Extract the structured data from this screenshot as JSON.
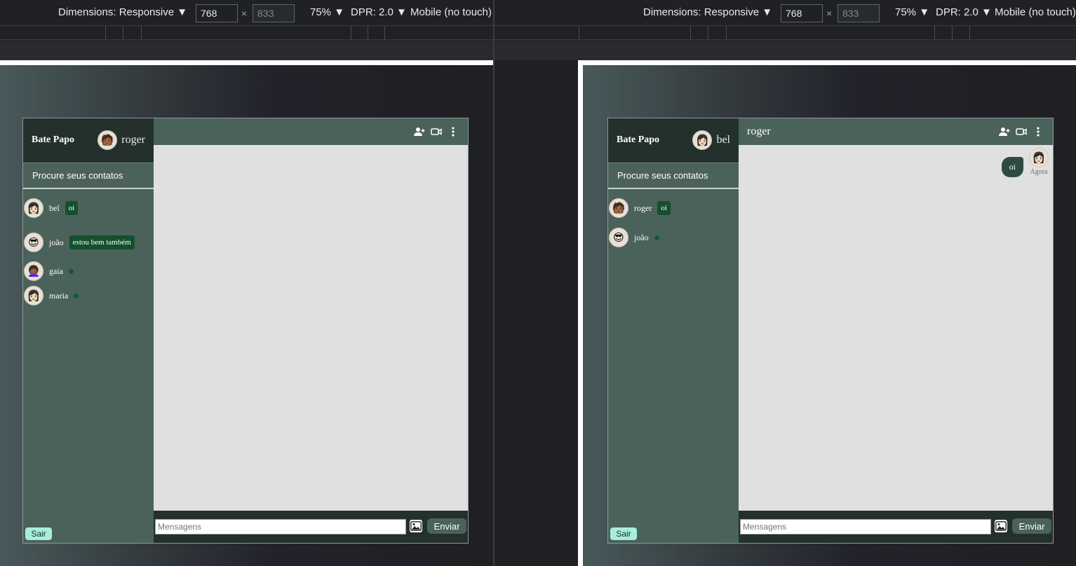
{
  "devtools": {
    "dimensions_label": "Dimensions: Responsive ▼",
    "width_value": "768",
    "times": "×",
    "height_value": "833",
    "zoom_label": "75% ▼",
    "dpr_label": "DPR: 2.0 ▼",
    "mode_label": "Mobile (no touch)"
  },
  "left": {
    "app": {
      "brand": "Bate Papo",
      "current_user": {
        "name": "roger",
        "avatar": "🧑🏾"
      },
      "search_label": "Procure seus contatos",
      "chat_title": "",
      "contacts": [
        {
          "name": "bel",
          "avatar": "👩🏻",
          "last_message": "oi"
        },
        {
          "name": "joão",
          "avatar": "😎",
          "last_message": "estou bem também"
        },
        {
          "name": "gaia",
          "avatar": "👩🏾‍🦱",
          "online": true
        },
        {
          "name": "maria",
          "avatar": "👩🏻",
          "online": true
        }
      ],
      "logout_label": "Sair",
      "input_placeholder": "Mensagens",
      "send_label": "Enviar"
    }
  },
  "right": {
    "app": {
      "brand": "Bate Papo",
      "current_user": {
        "name": "bel",
        "avatar": "👩🏻"
      },
      "search_label": "Procure seus contatos",
      "chat_title": "roger",
      "contacts": [
        {
          "name": "roger",
          "avatar": "🧑🏾",
          "last_message": "oi"
        },
        {
          "name": "joão",
          "avatar": "😎",
          "online": true
        }
      ],
      "messages": [
        {
          "text": "oi",
          "time": "Agora",
          "avatar": "👩🏻"
        }
      ],
      "logout_label": "Sair",
      "input_placeholder": "Mensagens",
      "send_label": "Enviar"
    }
  },
  "colors": {
    "sidebar": "#4b625b",
    "header_dark": "#24302c",
    "badge": "#14502e",
    "chat_bg": "#e0e0e0",
    "logout": "#a8eedd"
  },
  "icons": [
    "add-user-icon",
    "video-camera-icon",
    "more-vertical-icon",
    "image-icon"
  ]
}
